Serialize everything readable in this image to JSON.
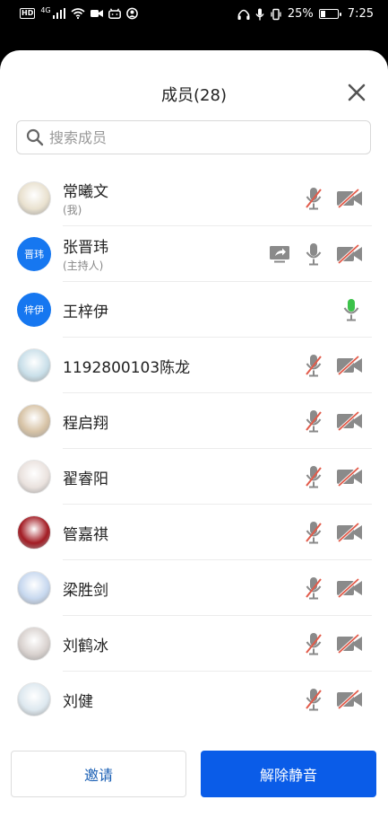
{
  "status_bar": {
    "hd_label": "HD",
    "network": "4G",
    "battery_percent": "25%",
    "time": "7:25"
  },
  "header": {
    "title": "成员(28)"
  },
  "search": {
    "placeholder": "搜索成员",
    "value": ""
  },
  "members": [
    {
      "name": "常曦文",
      "subtitle": "(我)",
      "avatar": "photo-avatar",
      "avatar_text": "",
      "mic": "muted",
      "camera": "off",
      "sharing": false
    },
    {
      "name": "张晋玮",
      "subtitle": "(主持人)",
      "avatar": "blue-avatar",
      "avatar_text": "晋玮",
      "mic": "on",
      "camera": "off",
      "sharing": true
    },
    {
      "name": "王梓伊",
      "subtitle": "",
      "avatar": "blue-avatar",
      "avatar_text": "梓伊",
      "mic": "speaking",
      "camera": "none",
      "sharing": false
    },
    {
      "name": "1192800103陈龙",
      "subtitle": "",
      "avatar": "photo-avatar",
      "avatar_text": "",
      "mic": "muted",
      "camera": "off",
      "sharing": false
    },
    {
      "name": "程启翔",
      "subtitle": "",
      "avatar": "photo-avatar",
      "avatar_text": "",
      "mic": "muted",
      "camera": "off",
      "sharing": false
    },
    {
      "name": "翟睿阳",
      "subtitle": "",
      "avatar": "photo-avatar",
      "avatar_text": "",
      "mic": "muted",
      "camera": "off",
      "sharing": false
    },
    {
      "name": "管嘉祺",
      "subtitle": "",
      "avatar": "photo-avatar",
      "avatar_text": "",
      "mic": "muted",
      "camera": "off",
      "sharing": false
    },
    {
      "name": "梁胜剑",
      "subtitle": "",
      "avatar": "photo-avatar",
      "avatar_text": "",
      "mic": "muted",
      "camera": "off",
      "sharing": false
    },
    {
      "name": "刘鹤冰",
      "subtitle": "",
      "avatar": "photo-avatar",
      "avatar_text": "",
      "mic": "muted",
      "camera": "off",
      "sharing": false
    },
    {
      "name": "刘健",
      "subtitle": "",
      "avatar": "photo-avatar",
      "avatar_text": "",
      "mic": "muted",
      "camera": "off",
      "sharing": false
    }
  ],
  "footer": {
    "invite_label": "邀请",
    "unmute_all_label": "解除静音"
  },
  "colors": {
    "accent": "#0a5ce8",
    "speaking_green": "#3cc24a",
    "muted_red": "#e25b4a",
    "icon_gray": "#8a8a8a"
  }
}
